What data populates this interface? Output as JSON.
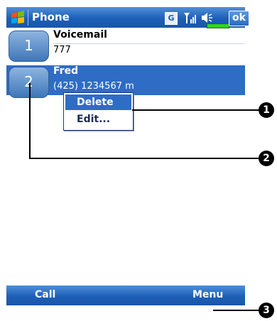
{
  "titlebar": {
    "app_title": "Phone",
    "network_badge": "G",
    "ok_label": "ok",
    "icons": [
      "windows-start-icon",
      "signal-icon",
      "speaker-icon",
      "battery-icon"
    ]
  },
  "contacts": [
    {
      "speed_dial": "1",
      "name": "Voicemail",
      "detail": "777"
    },
    {
      "speed_dial": "2",
      "name": "Fred",
      "detail": "(425) 1234567 m"
    }
  ],
  "context_menu": {
    "items": [
      "Delete",
      "Edit..."
    ]
  },
  "softkeys": {
    "left": "Call",
    "right": "Menu"
  },
  "callouts": [
    "1",
    "2",
    "3"
  ],
  "colors": {
    "titlebar_blue": "#1d5fb8",
    "selection_blue": "#2f6cc6",
    "battery_green": "#31d22b"
  }
}
